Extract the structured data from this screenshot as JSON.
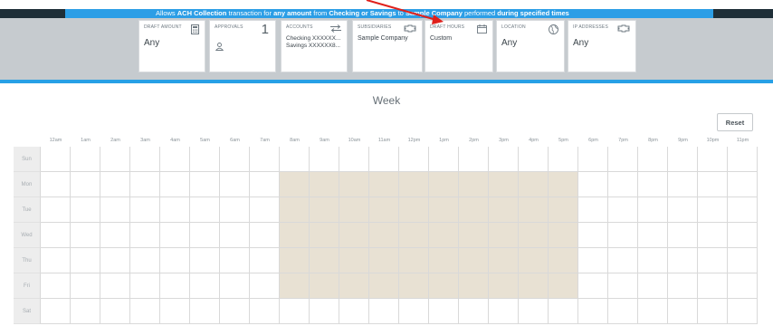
{
  "banner": {
    "seg1": "Allows ",
    "seg2": "ACH Collection",
    "seg3": " transaction for ",
    "seg4": "any amount",
    "seg5": " from ",
    "seg6": "Checking or Savings",
    "seg7": " to ",
    "seg8": "Sample Company",
    "seg9": " performed ",
    "seg10": "during specified times"
  },
  "filters": {
    "draft_amount": {
      "title": "DRAFT AMOUNT",
      "value": "Any",
      "icon": "calculator-icon"
    },
    "approvals": {
      "title": "APPROVALS",
      "count": "1",
      "icon": "person-icon"
    },
    "accounts": {
      "title": "ACCOUNTS",
      "line1": "Checking XXXXXX...",
      "line2": "Savings XXXXXX8...",
      "icon": "transfer-arrows-icon"
    },
    "subsidiaries": {
      "title": "SUBSIDIARIES",
      "value": "Sample Company",
      "icon": "puzzle-icon"
    },
    "draft_hours": {
      "title": "DRAFT HOURS",
      "value": "Custom",
      "icon": "calendar-icon"
    },
    "location": {
      "title": "LOCATION",
      "value": "Any",
      "icon": "globe-icon"
    },
    "ip_addresses": {
      "title": "IP ADDRESSES",
      "value": "Any",
      "icon": "puzzle-icon"
    }
  },
  "schedule": {
    "title": "Week",
    "reset_label": "Reset",
    "hours": [
      "12am",
      "1am",
      "2am",
      "3am",
      "4am",
      "5am",
      "6am",
      "7am",
      "8am",
      "9am",
      "10am",
      "11am",
      "12pm",
      "1pm",
      "2pm",
      "3pm",
      "4pm",
      "5pm",
      "6pm",
      "7pm",
      "8pm",
      "9pm",
      "10pm",
      "11pm"
    ],
    "days": [
      "Sun",
      "Mon",
      "Tue",
      "Wed",
      "Thu",
      "Fri",
      "Sat"
    ],
    "active_days": [
      "Mon",
      "Tue",
      "Wed",
      "Thu",
      "Fri"
    ],
    "active_hours": [
      "8am",
      "9am",
      "10am",
      "11am",
      "12pm",
      "1pm",
      "2pm",
      "3pm",
      "4pm",
      "5pm"
    ],
    "active_color": "#e8e1d3"
  },
  "colors": {
    "banner_blue": "#2c9ee6",
    "banner_dark": "#1f2f38",
    "annotation_red": "#e0201b"
  }
}
